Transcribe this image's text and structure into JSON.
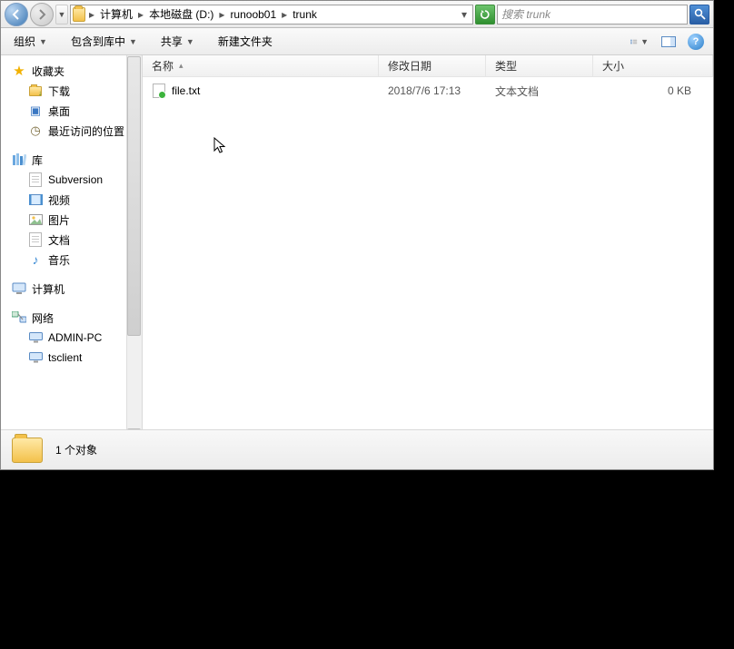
{
  "breadcrumb": {
    "b0": "计算机",
    "b1": "本地磁盘 (D:)",
    "b2": "runoob01",
    "b3": "trunk"
  },
  "search": {
    "placeholder": "搜索 trunk"
  },
  "toolbar": {
    "organize": "组织",
    "include": "包含到库中",
    "share": "共享",
    "newfolder": "新建文件夹"
  },
  "columns": {
    "name": "名称",
    "modified": "修改日期",
    "type": "类型",
    "size": "大小"
  },
  "nav": {
    "fav": "收藏夹",
    "downloads": "下载",
    "desktop": "桌面",
    "recent": "最近访问的位置",
    "lib": "库",
    "subversion": "Subversion",
    "videos": "视频",
    "pictures": "图片",
    "docs": "文档",
    "music": "音乐",
    "computer": "计算机",
    "network": "网络",
    "adminpc": "ADMIN-PC",
    "tsclient": "tsclient"
  },
  "files": [
    {
      "name": "file.txt",
      "modified": "2018/7/6 17:13",
      "type": "文本文档",
      "size": "0 KB"
    }
  ],
  "status": {
    "count": "1 个对象"
  }
}
